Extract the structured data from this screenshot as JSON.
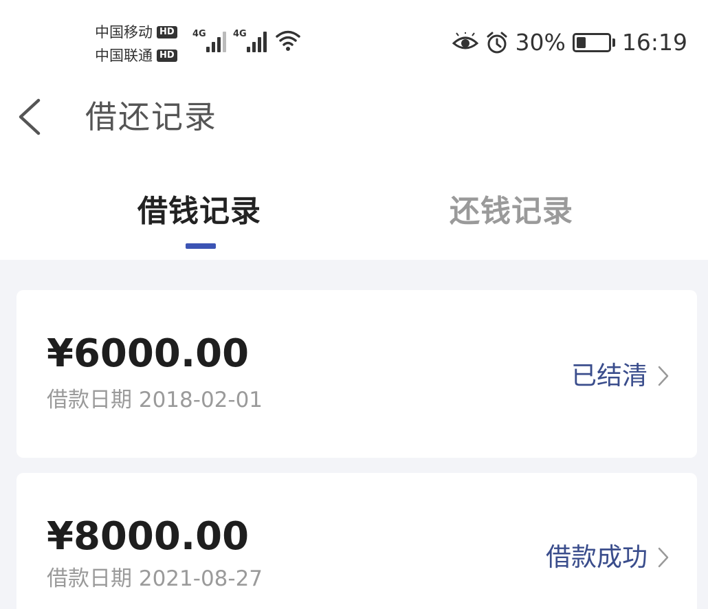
{
  "status_bar": {
    "carrier_1": "中国移动",
    "carrier_2": "中国联通",
    "hd_label": "HD",
    "network_1": "4G",
    "network_2": "4G",
    "battery_percent": "30%",
    "battery_level": 0.3,
    "time": "16:19",
    "icons": [
      "eye-icon",
      "alarm-icon",
      "wifi-icon",
      "battery-icon"
    ]
  },
  "header": {
    "title": "借还记录",
    "back_icon": "chevron-left-icon"
  },
  "tabs": [
    {
      "label": "借钱记录",
      "active": true
    },
    {
      "label": "还钱记录",
      "active": false
    }
  ],
  "colors": {
    "accent": "#3c54b4",
    "status_link": "#3a4d8c",
    "background": "#f3f4f8"
  },
  "records": [
    {
      "amount": "¥6000.00",
      "date_label": "借款日期",
      "date": "2018-02-01",
      "status": "已结清"
    },
    {
      "amount": "¥8000.00",
      "date_label": "借款日期",
      "date": "2021-08-27",
      "status": "借款成功"
    }
  ]
}
